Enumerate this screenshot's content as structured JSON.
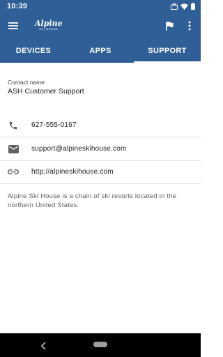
{
  "status_bar": {
    "time": "10:39"
  },
  "app_bar": {
    "logo_main": "Alpine",
    "logo_sub": "SKI HOUSE"
  },
  "tabs": [
    {
      "label": "DEVICES",
      "active": false
    },
    {
      "label": "APPS",
      "active": false
    },
    {
      "label": "SUPPORT",
      "active": true
    }
  ],
  "contact": {
    "label": "Contact name",
    "name": "ASH Customer Support"
  },
  "rows": {
    "phone": {
      "icon": "phone-icon",
      "value": "627-555-0167"
    },
    "email": {
      "icon": "email-icon",
      "value": "support@alpineskihouse.com"
    },
    "website": {
      "icon": "link-icon",
      "value": "http://alpineskihouse.com"
    }
  },
  "description": "Alpine Ski House is a chain of ski resorts located in the northern United States.",
  "colors": {
    "primary": "#2f5f96",
    "icon_gray": "#616161"
  }
}
